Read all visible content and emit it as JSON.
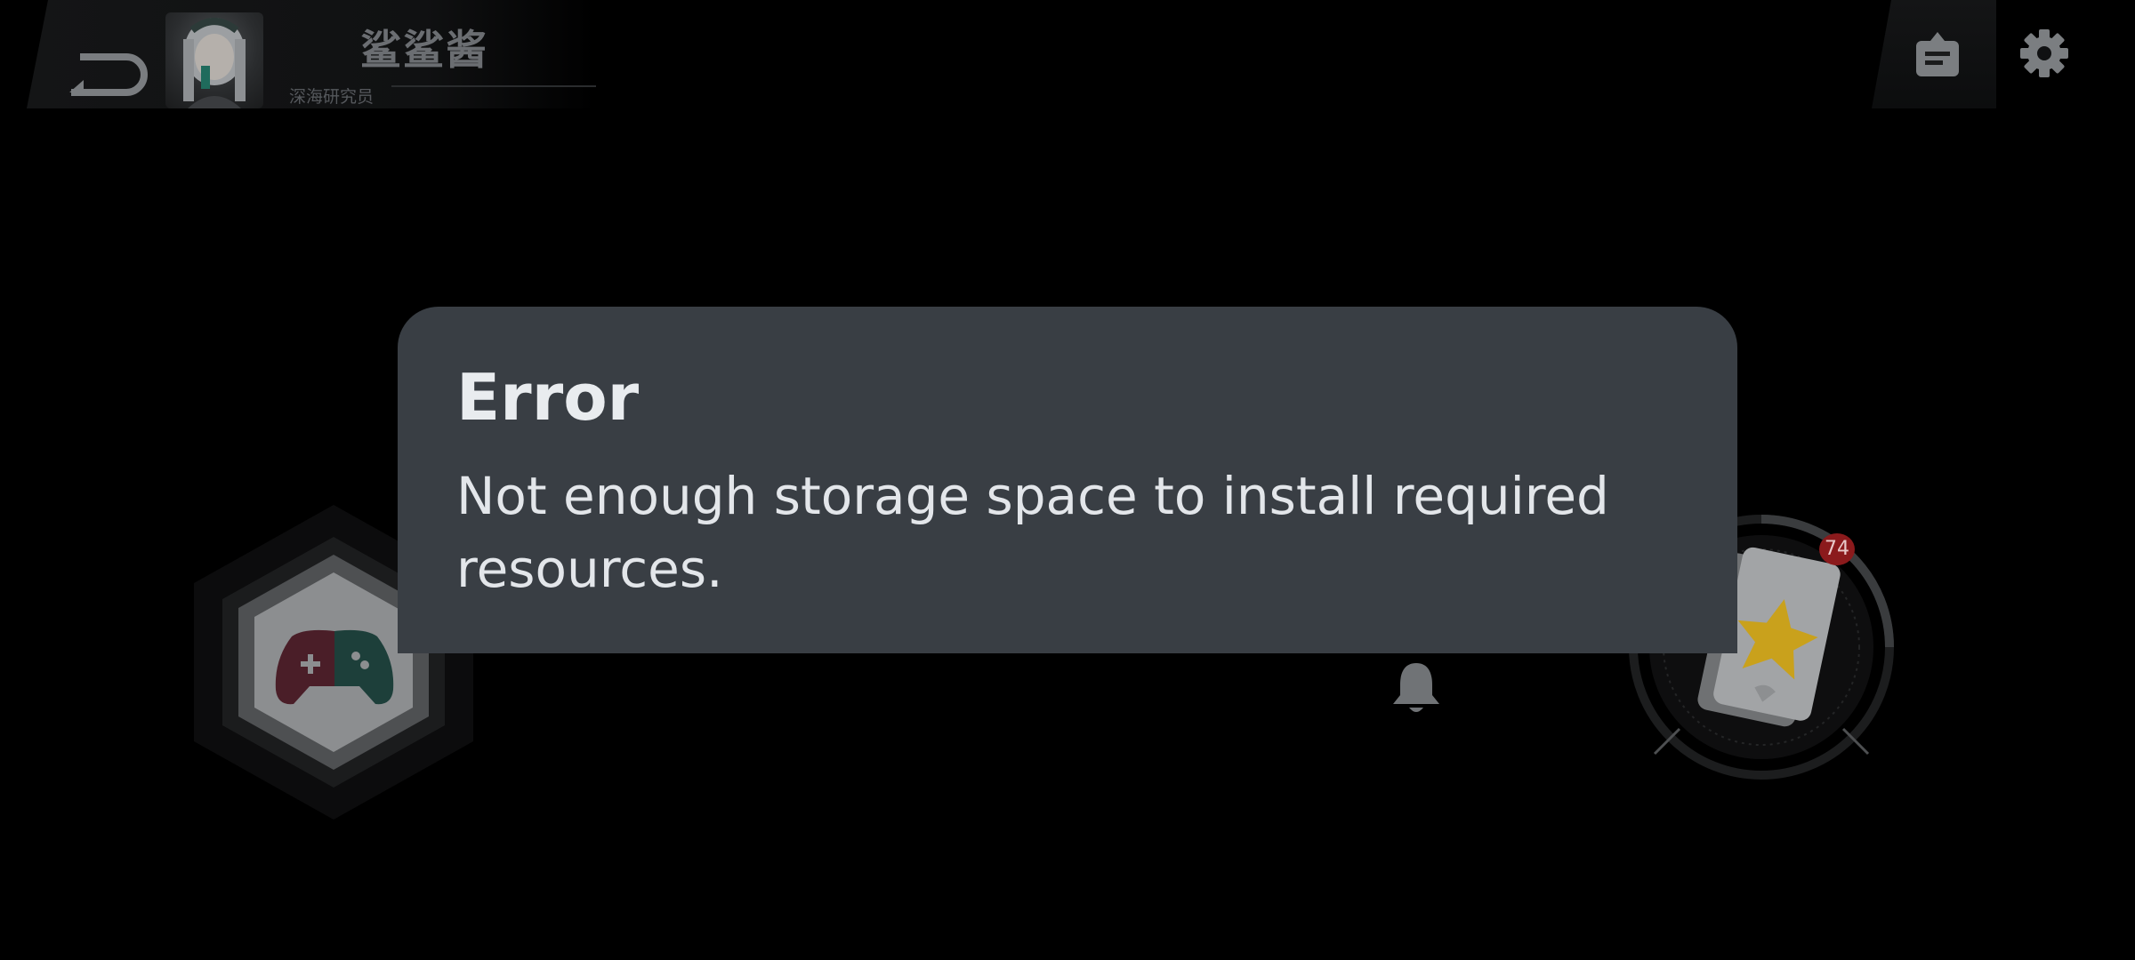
{
  "header": {
    "username": "鲨鲨酱",
    "user_title": "深海研究员"
  },
  "icons": {
    "back": "back-arrow-icon",
    "notice": "notice-board-icon",
    "settings": "gear-icon",
    "game": "gamepad-icon",
    "bell": "bell-icon",
    "card": "star-card-icon"
  },
  "card_badge": {
    "count": "74"
  },
  "dialog": {
    "title": "Error",
    "message": "Not enough storage space to install required resources."
  },
  "colors": {
    "dialog_bg": "#393e44",
    "badge_red": "#8b1a1c",
    "star_yellow": "#c9a11c"
  }
}
